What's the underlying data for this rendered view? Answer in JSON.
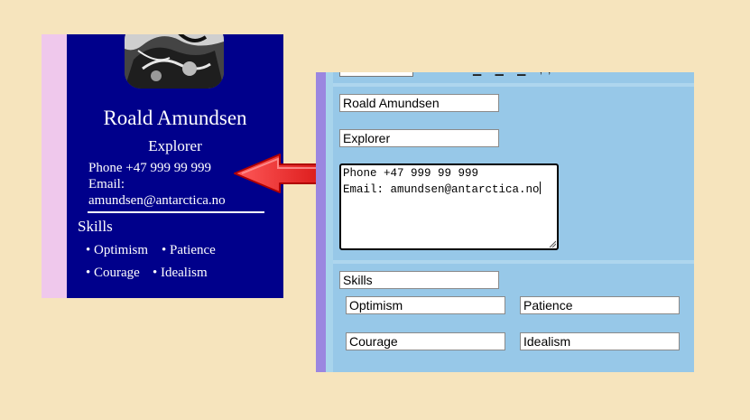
{
  "preview": {
    "name": "Roald Amundsen",
    "title": "Explorer",
    "contact_lines": "Phone +47 999 99 999\nEmail:\namundsen@antarctica.no",
    "skills_heading": "Skills",
    "skills": [
      "• Optimism",
      "• Patience",
      "• Courage",
      "• Idealism"
    ]
  },
  "editor": {
    "top_marks": "▁ ▁ ▁ ,,",
    "name_value": "Roald Amundsen",
    "title_value": "Explorer",
    "contact_value": "Phone +47 999 99 999\nEmail: amundsen@antarctica.no",
    "skills_heading_value": "Skills",
    "skills": [
      "Optimism",
      "Patience",
      "Courage",
      "Idealism"
    ]
  },
  "colors": {
    "page_bg": "#f6e4bd",
    "preview_bg": "#00008b",
    "preview_strip": "#efc8ec",
    "editor_bg": "#97c8e8",
    "editor_edge": "#9b86e0",
    "arrow": "#ee2222"
  },
  "icons": {
    "arrow": "left-arrow-icon",
    "photo": "portrait-photo"
  }
}
